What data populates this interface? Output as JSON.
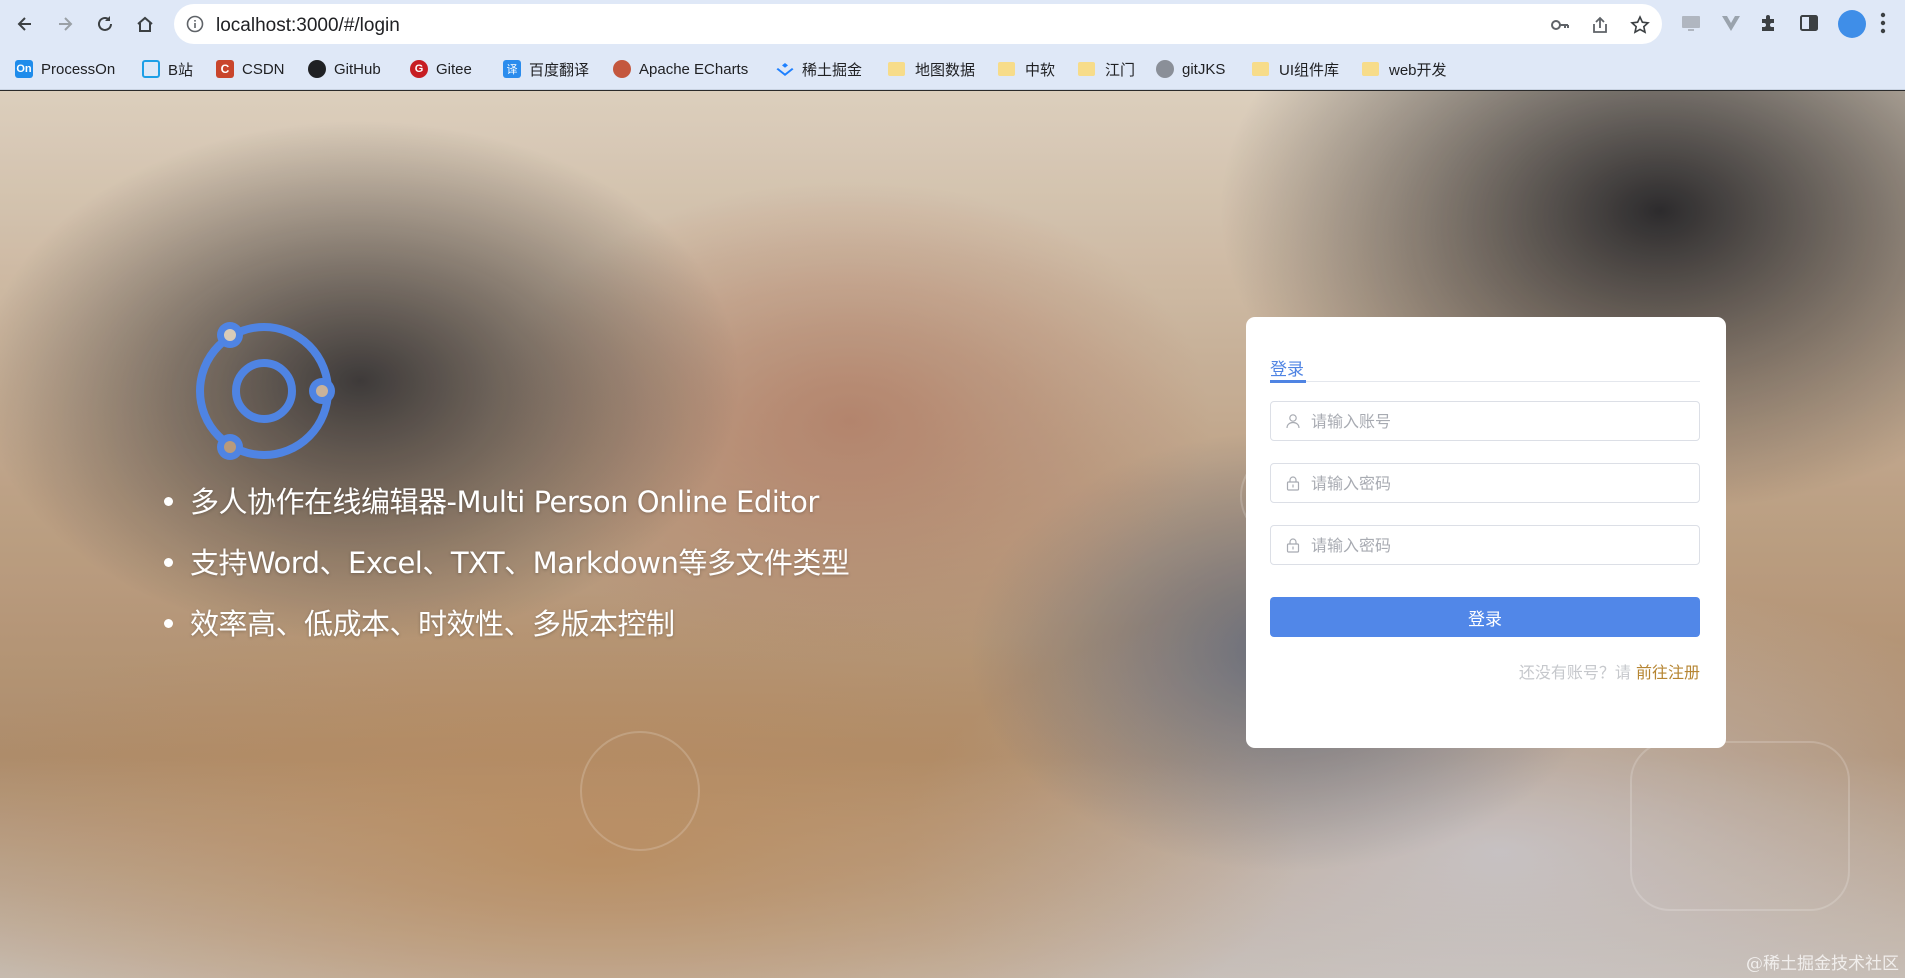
{
  "browser": {
    "url": "localhost:3000/#/login",
    "bookmarks": [
      {
        "label": "ProcessOn",
        "icon": "processon-icon",
        "color": "#1f8ceb"
      },
      {
        "label": "B站",
        "icon": "bilibili-icon",
        "color": "#1e9fe6"
      },
      {
        "label": "CSDN",
        "icon": "csdn-icon",
        "color": "#c9452c"
      },
      {
        "label": "GitHub",
        "icon": "github-icon",
        "color": "#202124"
      },
      {
        "label": "Gitee",
        "icon": "gitee-icon",
        "color": "#c71d23"
      },
      {
        "label": "百度翻译",
        "icon": "baidu-translate-icon",
        "color": "#2b8ced"
      },
      {
        "label": "Apache ECharts",
        "icon": "echarts-icon",
        "color": "#c4573e"
      },
      {
        "label": "稀土掘金",
        "icon": "juejin-icon",
        "color": "#1e80ff"
      },
      {
        "label": "地图数据",
        "icon": "folder-icon"
      },
      {
        "label": "中软",
        "icon": "folder-icon"
      },
      {
        "label": "江门",
        "icon": "folder-icon"
      },
      {
        "label": "gitJKS",
        "icon": "avatar-icon"
      },
      {
        "label": "UI组件库",
        "icon": "folder-icon"
      },
      {
        "label": "web开发",
        "icon": "folder-icon"
      }
    ]
  },
  "hero": {
    "logo_color": "#4f84e3",
    "features": [
      "多人协作在线编辑器-Multi Person Online Editor",
      "支持Word、Excel、TXT、Markdown等多文件类型",
      "效率高、低成本、时效性、多版本控制"
    ]
  },
  "login": {
    "tab_label": "登录",
    "account_placeholder": "请输入账号",
    "password_placeholder": "请输入密码",
    "confirm_password_placeholder": "请输入密码",
    "submit_label": "登录",
    "register_prompt": "还没有账号？请",
    "register_link": "前往注册",
    "accent_color": "#5187e8"
  },
  "watermark": "@稀土掘金技术社区"
}
